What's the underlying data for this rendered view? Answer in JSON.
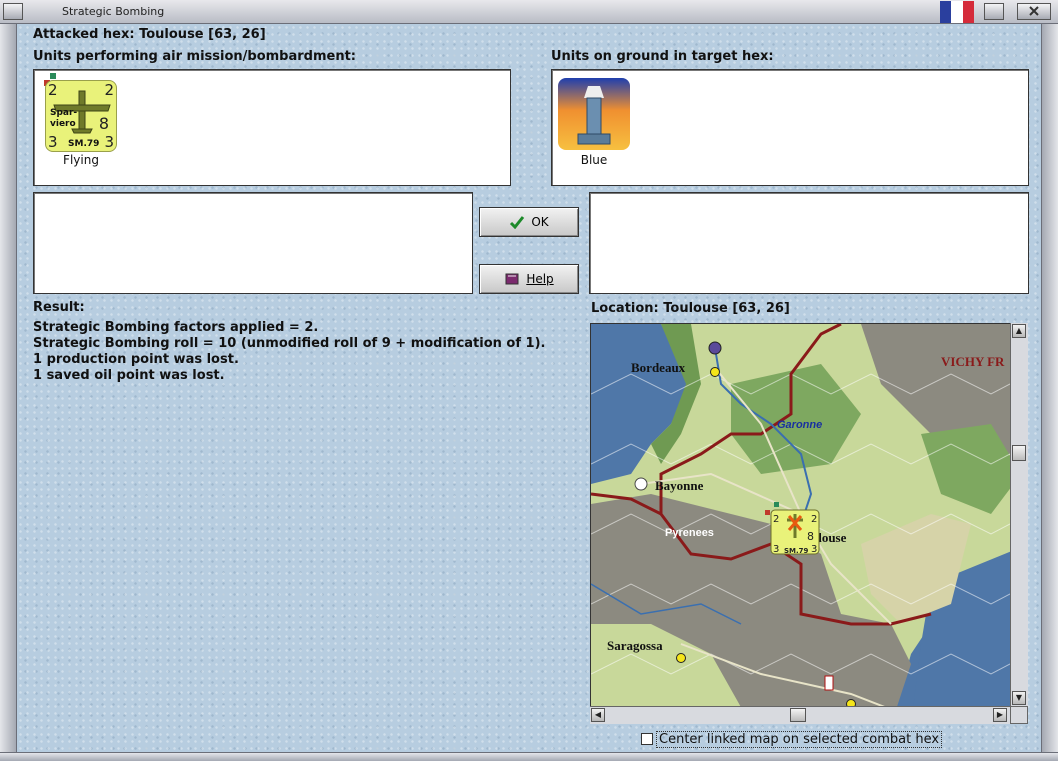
{
  "window": {
    "title": "Strategic Bombing"
  },
  "flag_colors": [
    "#2a3f9e",
    "#ffffff",
    "#d52b3a"
  ],
  "attacked_hex": "Attacked hex: Toulouse  [63, 26]",
  "air_units_label": "Units performing air mission/bombardment:",
  "ground_units_label": "Units on ground in target hex:",
  "air_units": [
    {
      "name_line1": "Spar-",
      "name_line2": "viero",
      "model": "SM.79",
      "top_left": "2",
      "top_right": "2",
      "bottom_left": "3",
      "bottom_right": "3",
      "right_mid": "8",
      "status": "Flying",
      "icon": "bomber-plane-icon"
    }
  ],
  "ground_units": [
    {
      "status": "Blue",
      "icon": "lighthouse-icon"
    }
  ],
  "buttons": {
    "ok": "OK",
    "help": "Help"
  },
  "result_label": "Result:",
  "result_lines": [
    "Strategic Bombing factors applied = 2.",
    "Strategic Bombing roll = 10 (unmodified roll of 9 + modification of 1).",
    "1 production point was lost.",
    "1 saved oil point was lost."
  ],
  "location_label": "Location:  Toulouse  [63, 26]",
  "map": {
    "places": [
      "Bordeaux",
      "Garonne",
      "Bayonne",
      "Pyrenees",
      "Toulouse",
      "Saragossa",
      "VICHY FR"
    ],
    "counter": {
      "top_left": "2",
      "top_right": "2",
      "bottom_left": "3",
      "bottom_right": "3",
      "right_mid": "8",
      "model": "SM.79"
    }
  },
  "center_map_label": "Center linked map on selected combat hex"
}
